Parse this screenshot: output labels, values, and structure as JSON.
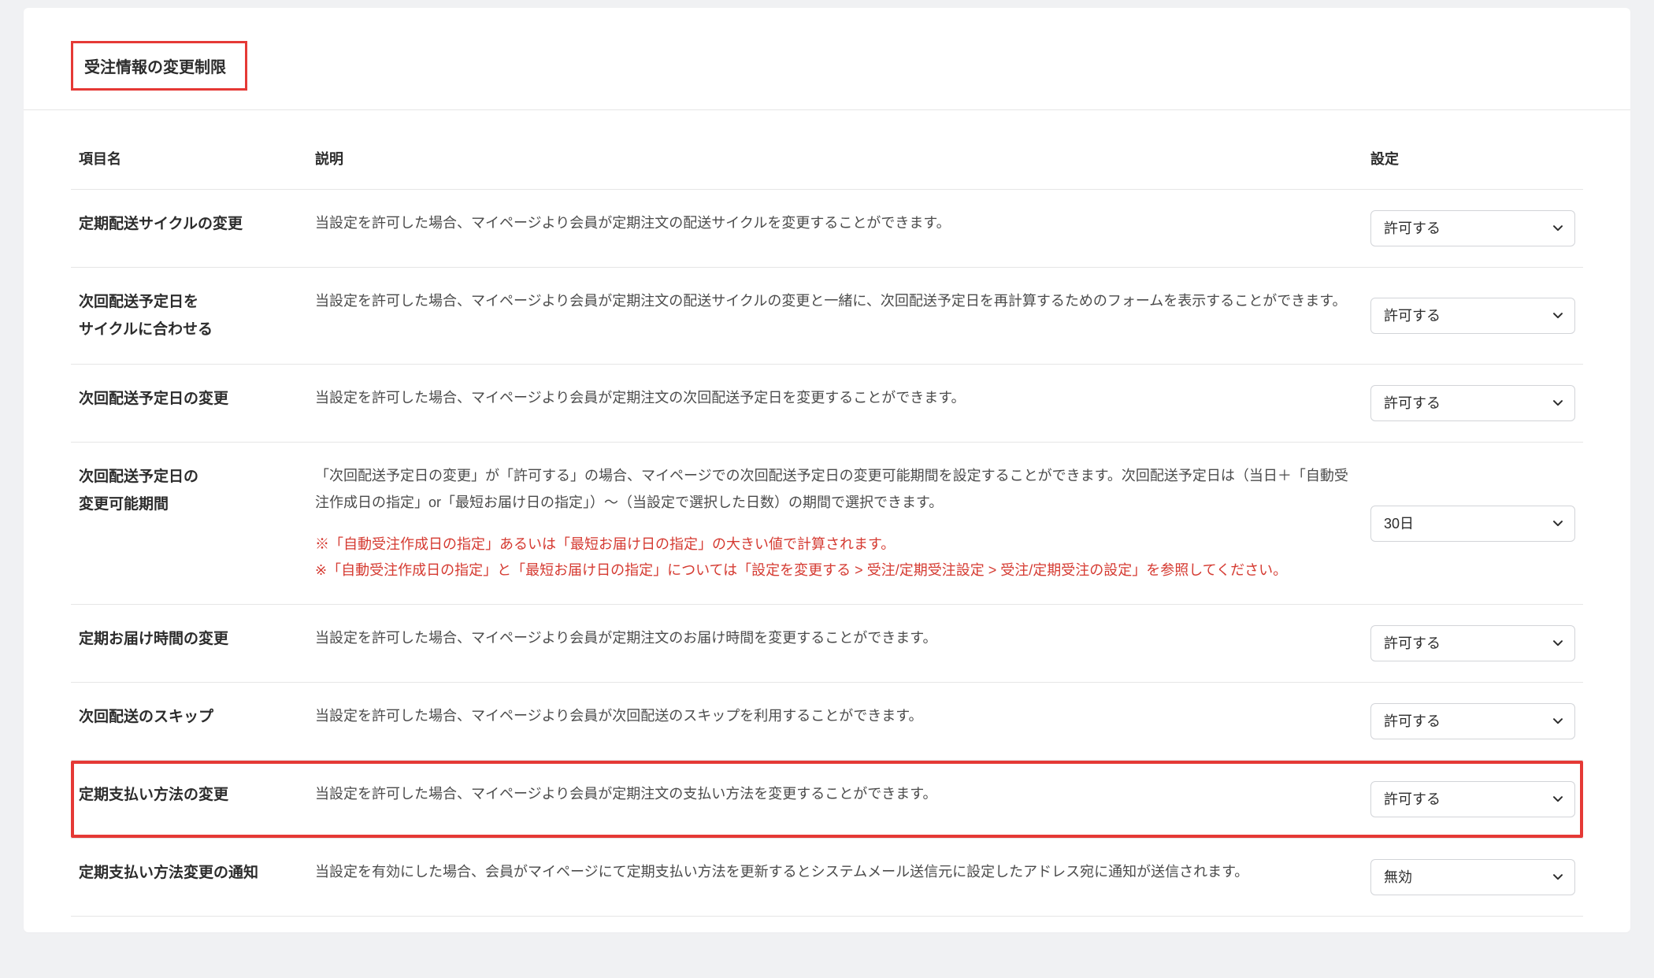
{
  "section_title": "受注情報の変更制限",
  "table": {
    "headers": {
      "name": "項目名",
      "desc": "説明",
      "setting": "設定"
    },
    "rows": [
      {
        "name": "定期配送サイクルの変更",
        "desc": "当設定を許可した場合、マイページより会員が定期注文の配送サイクルを変更することができます。",
        "setting": "許可する",
        "highlight": false
      },
      {
        "name": "次回配送予定日を\nサイクルに合わせる",
        "desc": "当設定を許可した場合、マイページより会員が定期注文の配送サイクルの変更と一緒に、次回配送予定日を再計算するためのフォームを表示することができます。",
        "setting": "許可する",
        "highlight": false
      },
      {
        "name": "次回配送予定日の変更",
        "desc": "当設定を許可した場合、マイページより会員が定期注文の次回配送予定日を変更することができます。",
        "setting": "許可する",
        "highlight": false
      },
      {
        "name": "次回配送予定日の\n変更可能期間",
        "desc": "「次回配送予定日の変更」が「許可する」の場合、マイページでの次回配送予定日の変更可能期間を設定することができます。次回配送予定日は（当日＋「自動受注作成日の指定」or「最短お届け日の指定」）～（当設定で選択した日数）の期間で選択できます。",
        "note": "※「自動受注作成日の指定」あるいは「最短お届け日の指定」の大きい値で計算されます。\n※「自動受注作成日の指定」と「最短お届け日の指定」については「設定を変更する > 受注/定期受注設定 > 受注/定期受注の設定」を参照してください。",
        "setting": "30日",
        "highlight": false
      },
      {
        "name": "定期お届け時間の変更",
        "desc": "当設定を許可した場合、マイページより会員が定期注文のお届け時間を変更することができます。",
        "setting": "許可する",
        "highlight": false
      },
      {
        "name": "次回配送のスキップ",
        "desc": "当設定を許可した場合、マイページより会員が次回配送のスキップを利用することができます。",
        "setting": "許可する",
        "highlight": false
      },
      {
        "name": "定期支払い方法の変更",
        "desc": "当設定を許可した場合、マイページより会員が定期注文の支払い方法を変更することができます。",
        "setting": "許可する",
        "highlight": true
      },
      {
        "name": "定期支払い方法変更の通知",
        "desc": "当設定を有効にした場合、会員がマイページにて定期支払い方法を更新するとシステムメール送信元に設定したアドレス宛に通知が送信されます。",
        "setting": "無効",
        "highlight": false
      }
    ]
  }
}
